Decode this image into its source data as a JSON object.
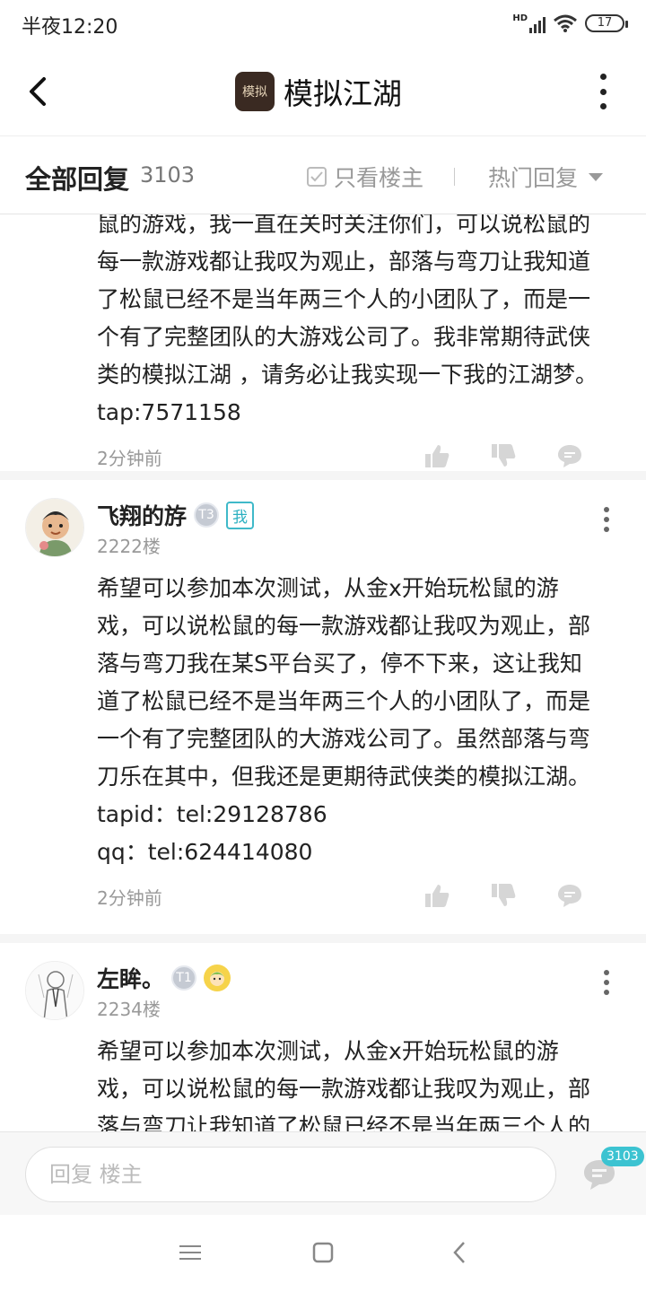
{
  "status_bar": {
    "time": "半夜12:20",
    "network_label": "HD",
    "battery": "17"
  },
  "header": {
    "title": "模拟江湖",
    "logo_text": "模拟"
  },
  "filter": {
    "all_label": "全部回复",
    "count": "3103",
    "only_op_label": "只看楼主",
    "sort_label": "热门回复"
  },
  "posts": [
    {
      "lines": [
        "鼠的游戏，我一直在关时关注你们，可以说松鼠的",
        "每一款游戏都让我叹为观止，部落与弯刀让我知道",
        "了松鼠已经不是当年两三个人的小团队了，而是一",
        "个有了完整团队的大游戏公司了。我非常期待武侠",
        "类的模拟江湖 ，请务必让我实现一下我的江湖梦。",
        "tap:7571158"
      ],
      "time": "2分钟前"
    },
    {
      "username": "飞翔的斿",
      "level": "T3",
      "me_tag": "我",
      "floor": "2222楼",
      "lines": [
        "希望可以参加本次测试，从金x开始玩松鼠的游",
        "戏，可以说松鼠的每一款游戏都让我叹为观止，部",
        "落与弯刀我在某S平台买了，停不下来，这让我知",
        "道了松鼠已经不是当年两三个人的小团队了，而是",
        "一个有了完整团队的大游戏公司了。虽然部落与弯",
        "刀乐在其中，但我还是更期待武侠类的模拟江湖。",
        "tapid：tel:29128786",
        "qq：tel:624414080"
      ],
      "time": "2分钟前"
    },
    {
      "username": "左眸。",
      "level": "T1",
      "floor": "2234楼",
      "lines": [
        "希望可以参加本次测试，从金x开始玩松鼠的游",
        "戏，可以说松鼠的每一款游戏都让我叹为观止，部",
        "落与弯刀让我知道了松鼠已经不是当年两三个人的"
      ]
    }
  ],
  "reply_bar": {
    "placeholder": "回复  楼主",
    "comment_count": "3103"
  },
  "colors": {
    "accent": "#3cc3d1",
    "text_primary": "#222222",
    "text_secondary": "#999999"
  }
}
